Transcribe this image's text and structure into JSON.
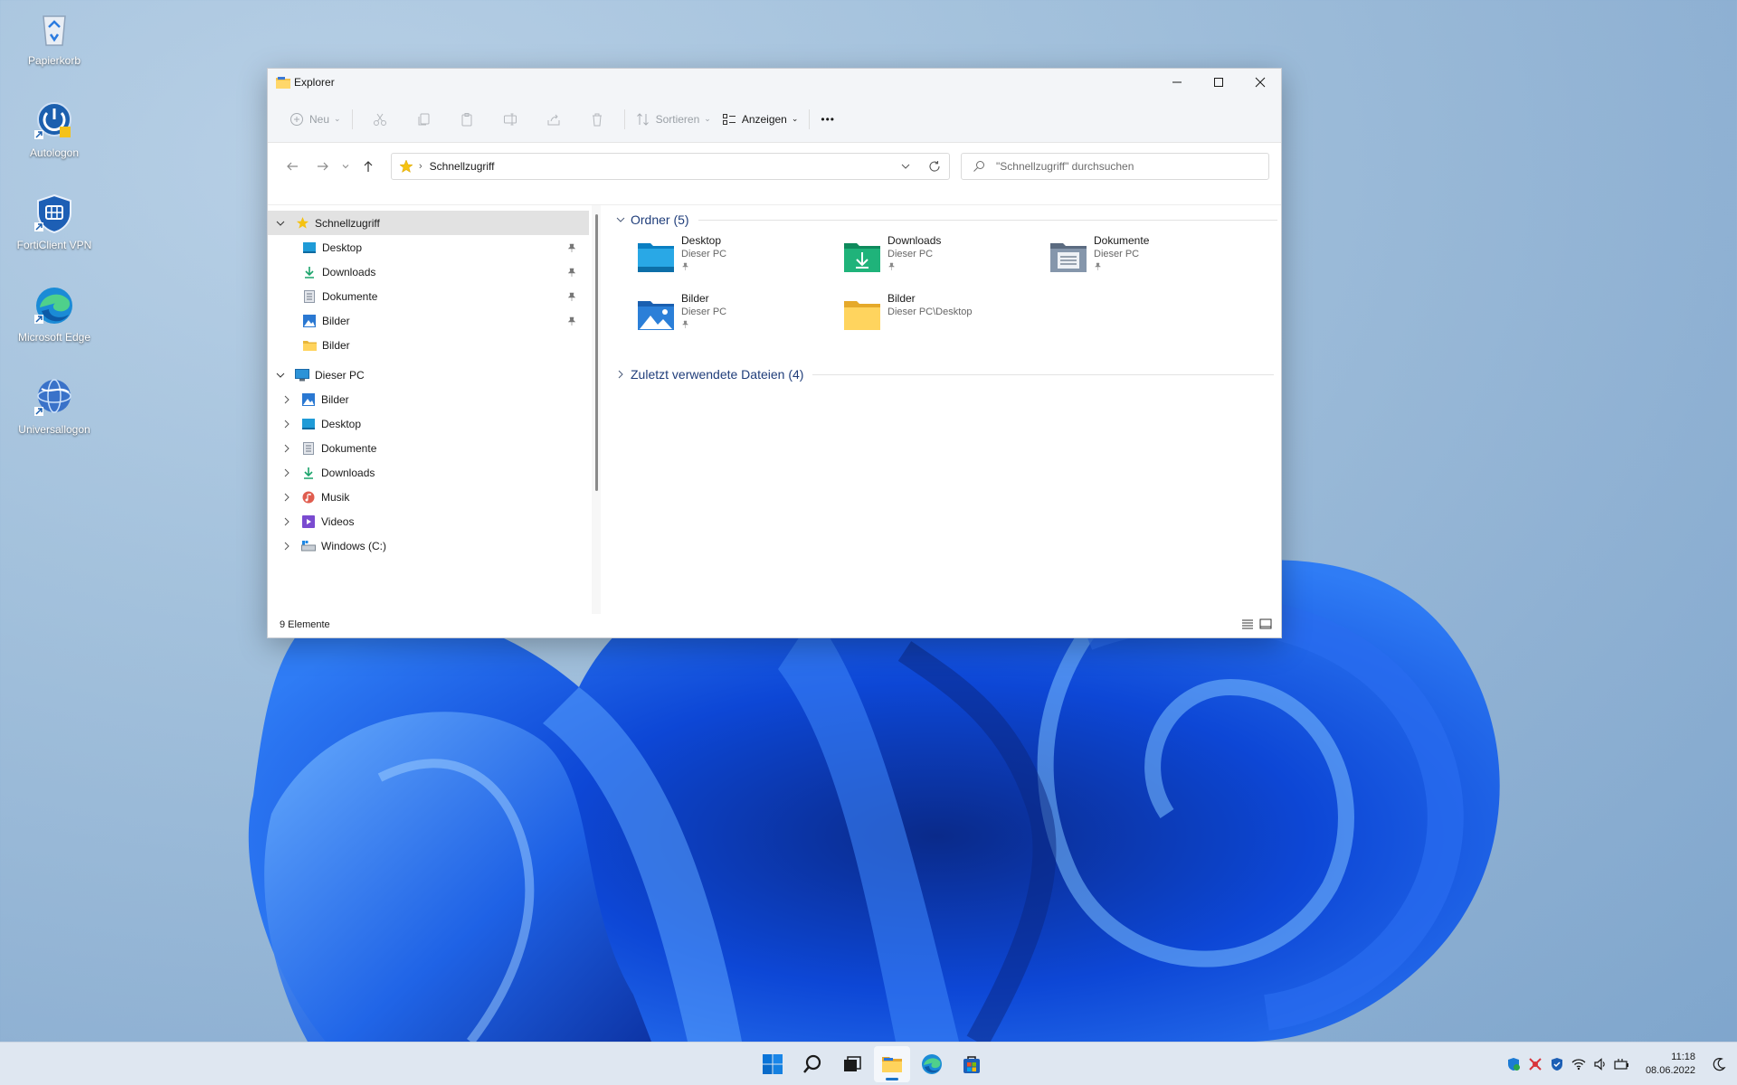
{
  "desktop": {
    "icons": [
      {
        "label": "Papierkorb",
        "icon": "recycle-bin-icon"
      },
      {
        "label": "Autologon",
        "icon": "autologon-icon"
      },
      {
        "label": "FortiClient VPN",
        "icon": "forticlient-icon"
      },
      {
        "label": "Microsoft Edge",
        "icon": "edge-icon"
      },
      {
        "label": "Universallogon",
        "icon": "universallogon-icon"
      }
    ]
  },
  "window": {
    "title": "Explorer",
    "toolbar": {
      "new_label": "Neu",
      "sort_label": "Sortieren",
      "view_label": "Anzeigen",
      "more_label": "•••"
    },
    "address": {
      "path": "Schnellzugriff",
      "search_placeholder": "\"Schnellzugriff\" durchsuchen"
    },
    "nav": {
      "quick_access": {
        "label": "Schnellzugriff",
        "items": [
          {
            "label": "Desktop",
            "icon": "desktop-folder-icon",
            "pinned": true
          },
          {
            "label": "Downloads",
            "icon": "downloads-icon",
            "pinned": true
          },
          {
            "label": "Dokumente",
            "icon": "documents-icon",
            "pinned": true
          },
          {
            "label": "Bilder",
            "icon": "pictures-icon",
            "pinned": true
          },
          {
            "label": "Bilder",
            "icon": "yellow-folder-icon",
            "pinned": false
          }
        ]
      },
      "this_pc": {
        "label": "Dieser PC",
        "items": [
          {
            "label": "Bilder",
            "icon": "pictures-icon"
          },
          {
            "label": "Desktop",
            "icon": "desktop-folder-icon"
          },
          {
            "label": "Dokumente",
            "icon": "documents-icon"
          },
          {
            "label": "Downloads",
            "icon": "downloads-icon"
          },
          {
            "label": "Musik",
            "icon": "music-icon"
          },
          {
            "label": "Videos",
            "icon": "videos-icon"
          },
          {
            "label": "Windows (C:)",
            "icon": "drive-icon"
          }
        ]
      }
    },
    "main": {
      "folders_header": "Ordner (5)",
      "folders": [
        {
          "name": "Desktop",
          "location": "Dieser PC",
          "pinned": true
        },
        {
          "name": "Downloads",
          "location": "Dieser PC",
          "pinned": true
        },
        {
          "name": "Dokumente",
          "location": "Dieser PC",
          "pinned": true
        },
        {
          "name": "Bilder",
          "location": "Dieser PC",
          "pinned": true
        },
        {
          "name": "Bilder",
          "location": "Dieser PC\\Desktop",
          "pinned": false
        }
      ],
      "recent_header": "Zuletzt verwendete Dateien (4)"
    },
    "status": {
      "items_count": "9 Elemente"
    }
  },
  "taskbar": {
    "clock_time": "11:18",
    "clock_date": "08.06.2022"
  }
}
